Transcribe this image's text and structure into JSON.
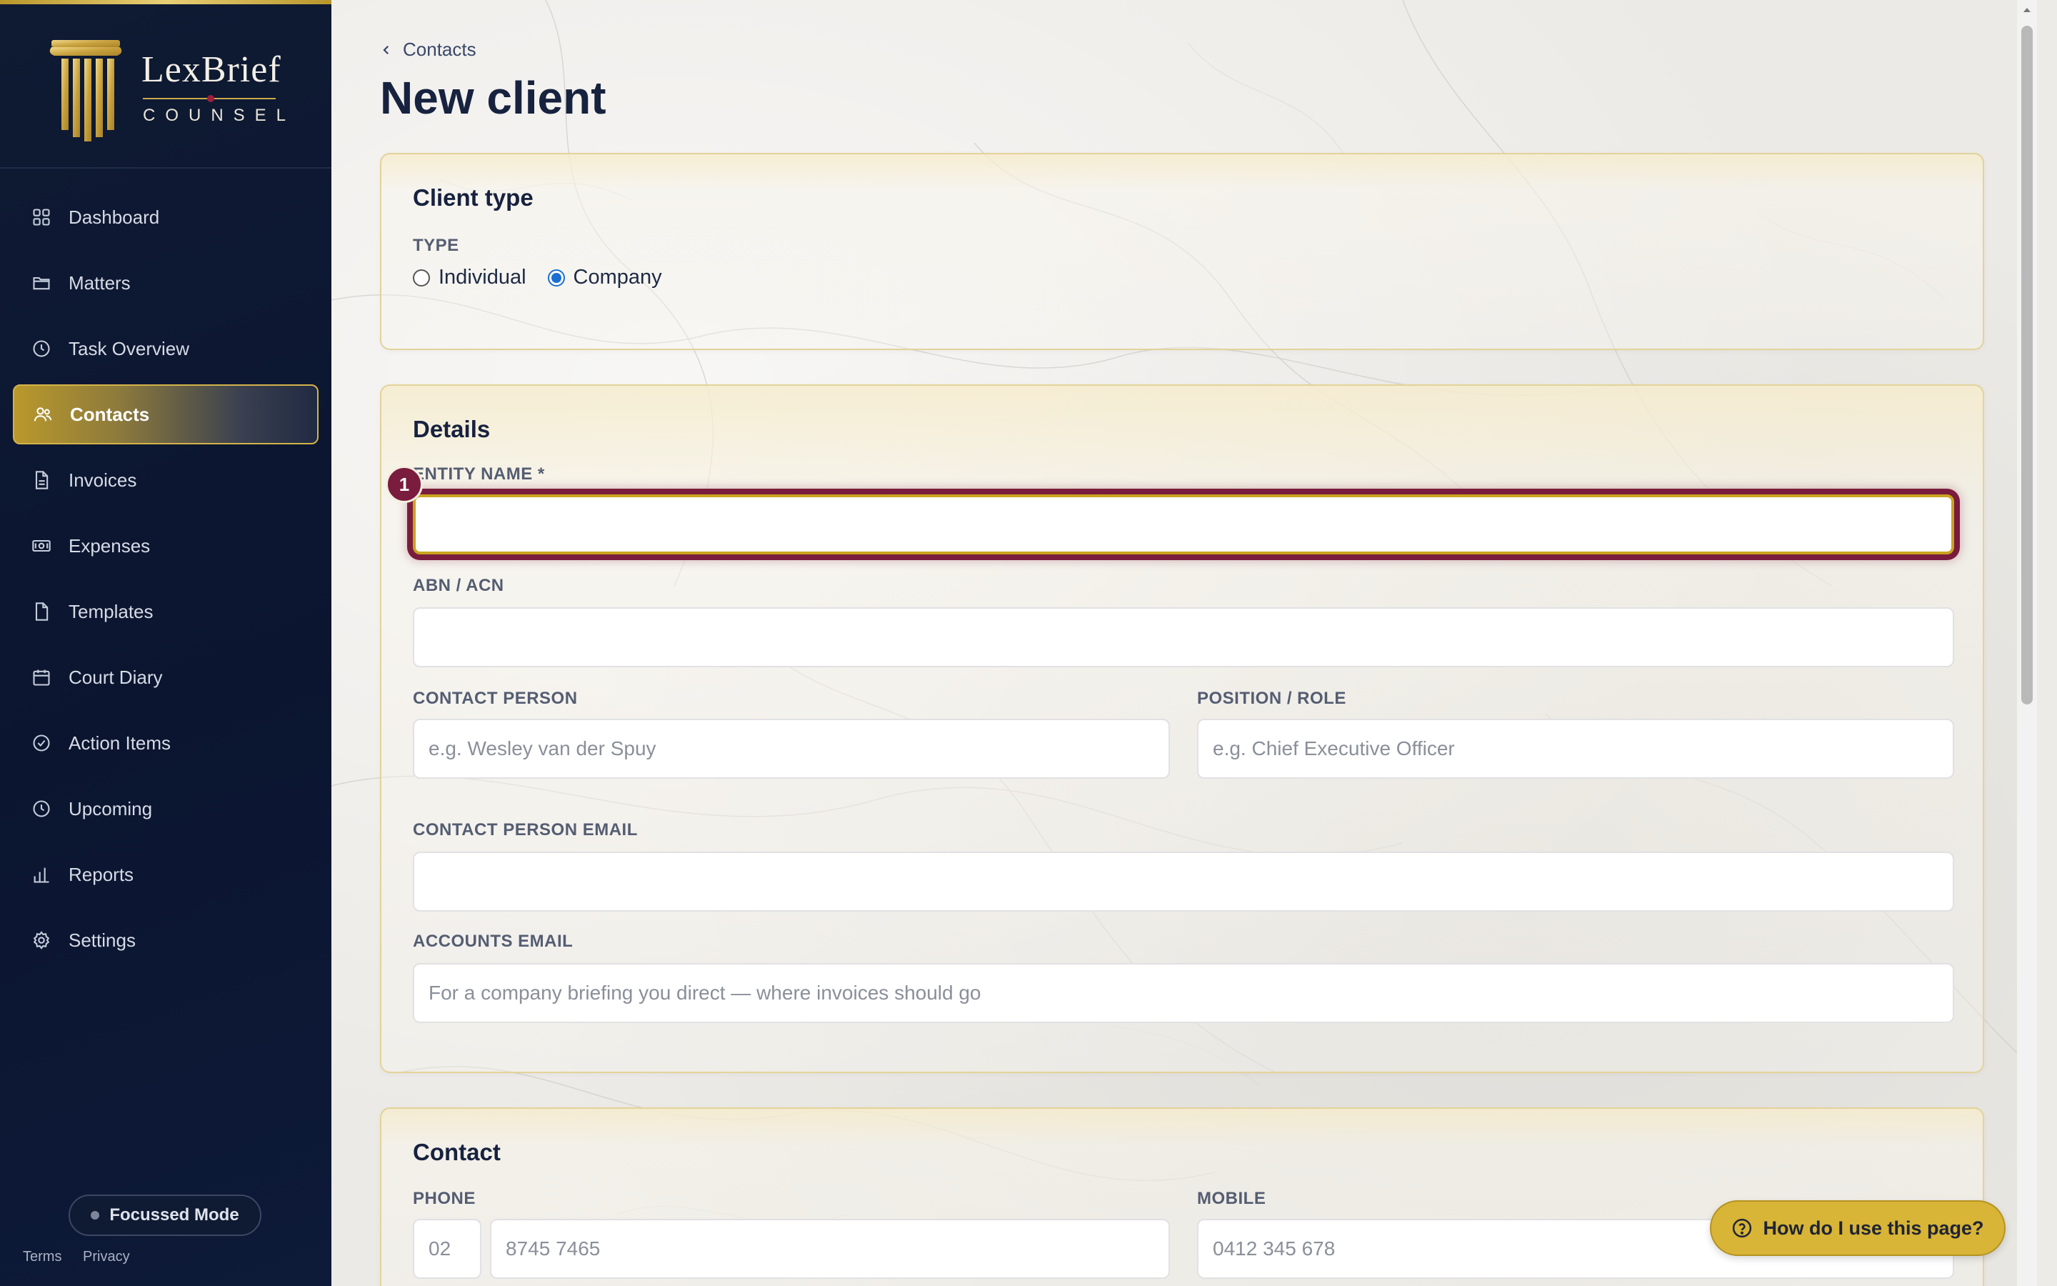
{
  "brand": {
    "name": "LexBrief",
    "sub": "COUNSEL"
  },
  "nav": [
    {
      "label": "Dashboard",
      "icon": "grid-icon"
    },
    {
      "label": "Matters",
      "icon": "folder-icon"
    },
    {
      "label": "Task Overview",
      "icon": "clock-icon"
    },
    {
      "label": "Contacts",
      "icon": "users-icon",
      "active": true
    },
    {
      "label": "Invoices",
      "icon": "file-text-icon"
    },
    {
      "label": "Expenses",
      "icon": "banknote-icon"
    },
    {
      "label": "Templates",
      "icon": "file-icon"
    },
    {
      "label": "Court Diary",
      "icon": "calendar-icon"
    },
    {
      "label": "Action Items",
      "icon": "check-circle-icon"
    },
    {
      "label": "Upcoming",
      "icon": "clock-icon"
    },
    {
      "label": "Reports",
      "icon": "bar-chart-icon"
    },
    {
      "label": "Settings",
      "icon": "gear-icon"
    }
  ],
  "sidebar_footer": {
    "focus_mode": "Focussed Mode",
    "terms": "Terms",
    "privacy": "Privacy"
  },
  "breadcrumb": "Contacts",
  "page_title": "New client",
  "client_type": {
    "title": "Client type",
    "type_label": "TYPE",
    "options": [
      "Individual",
      "Company"
    ],
    "selected": "Company"
  },
  "details": {
    "title": "Details",
    "entity_name_label": "ENTITY NAME *",
    "entity_name_value": "",
    "abn_label": "ABN / ACN",
    "abn_value": "",
    "contact_person_label": "CONTACT PERSON",
    "contact_person_placeholder": "e.g. Wesley van der Spuy",
    "position_label": "POSITION / ROLE",
    "position_placeholder": "e.g. Chief Executive Officer",
    "contact_email_label": "CONTACT PERSON EMAIL",
    "accounts_email_label": "ACCOUNTS EMAIL",
    "accounts_email_placeholder": "For a company briefing you direct — where invoices should go"
  },
  "contact": {
    "title": "Contact",
    "phone_label": "PHONE",
    "phone_area_placeholder": "02",
    "phone_number_placeholder": "8745 7465",
    "mobile_label": "MOBILE",
    "mobile_placeholder": "0412 345 678"
  },
  "step_badge": "1",
  "help_button": "How do I use this page?",
  "colors": {
    "gold": "#d8b437",
    "navy": "#0f1a33",
    "burgundy": "#7a1c3d",
    "radio_blue": "#1a6fd1"
  }
}
